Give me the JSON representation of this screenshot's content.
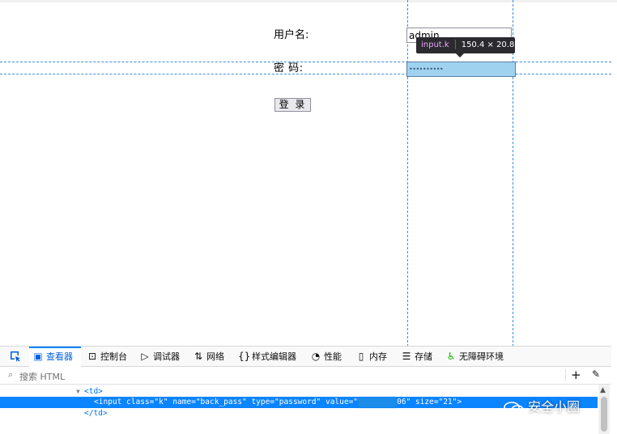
{
  "form": {
    "username_label": "用户名:",
    "password_label": "密 码:",
    "username_value": "admin",
    "password_value": "••••••••••",
    "login_button": "登 录"
  },
  "inspector_tooltip": {
    "selector": "input.k",
    "dimensions": "150.4 × 20.8"
  },
  "devtools": {
    "tabs": [
      {
        "label": "查看器",
        "icon": "inspector-icon",
        "selected": true
      },
      {
        "label": "控制台",
        "icon": "console-icon"
      },
      {
        "label": "调试器",
        "icon": "debugger-icon"
      },
      {
        "label": "网络",
        "icon": "network-icon"
      },
      {
        "label": "样式编辑器",
        "icon": "style-editor-icon"
      },
      {
        "label": "性能",
        "icon": "performance-icon"
      },
      {
        "label": "内存",
        "icon": "memory-icon"
      },
      {
        "label": "存储",
        "icon": "storage-icon"
      },
      {
        "label": "无障碍环境",
        "icon": "accessibility-icon"
      }
    ],
    "search_placeholder": "搜索 HTML",
    "markup": {
      "line1": "<td>",
      "line2_before": "<input class=\"k\" name=\"back_pass\" type=\"password\" value=\"",
      "line2_after": "06\" size=\"21\">",
      "line3": "</td>"
    }
  },
  "watermark": "安全小圈",
  "colors": {
    "guide_line": "#3a8fe0",
    "selected_row": "#0a84ff",
    "highlighted_input": "#9fd2ef",
    "tab_accent": "#0060df"
  }
}
